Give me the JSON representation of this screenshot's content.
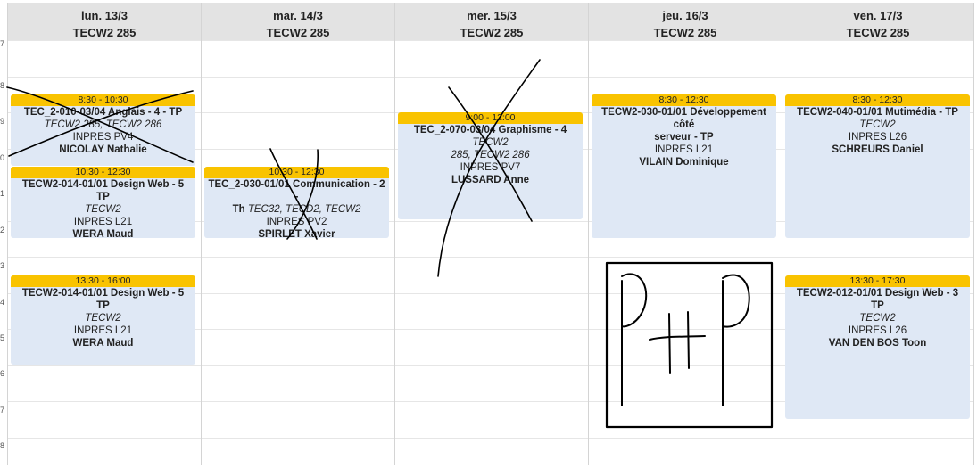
{
  "days": [
    {
      "date": "lun. 13/3",
      "room": "TECW2 285"
    },
    {
      "date": "mar. 14/3",
      "room": "TECW2 285"
    },
    {
      "date": "mer. 15/3",
      "room": "TECW2 285"
    },
    {
      "date": "jeu. 16/3",
      "room": "TECW2 285"
    },
    {
      "date": "ven. 17/3",
      "room": "TECW2 285"
    }
  ],
  "hour_ticks": [
    "7",
    "8",
    "9",
    "0",
    "1",
    "2",
    "3",
    "4",
    "5",
    "6",
    "7",
    "8"
  ],
  "events": [
    {
      "day": 0,
      "time": "8:30 - 10:30",
      "title": "TEC_2-010-03/04 Anglais - 4 - TP",
      "groups": "TECW2 285, TECW2 286",
      "location": "INPRES PV4",
      "teacher": "NICOLAY Nathalie"
    },
    {
      "day": 0,
      "time": "10:30 - 12:30",
      "title": "TECW2-014-01/01 Design Web - 5 TP",
      "groups": "TECW2",
      "location": "INPRES L21",
      "teacher": "WERA Maud"
    },
    {
      "day": 0,
      "time": "13:30 - 16:00",
      "title": "TECW2-014-01/01 Design Web - 5 TP",
      "groups": "TECW2",
      "location": "INPRES L21",
      "teacher": "WERA Maud"
    },
    {
      "day": 1,
      "time": "10:30 - 12:30",
      "title_main": "TEC_2-030-01/01 Communication - 2 -",
      "title_tail": "Th",
      "groups": "TEC32, TECD2, TECW2",
      "location": "INPRES PV2",
      "teacher": "SPIRLET Xavier"
    },
    {
      "day": 2,
      "time": "9:00 - 12:00",
      "title": "TEC_2-070-03/04 Graphisme - 4",
      "groups_a": "TECW2",
      "groups_b": "285, TECW2 286",
      "location": "INPRES PV7",
      "teacher": "LUSSARD Anne"
    },
    {
      "day": 3,
      "time": "8:30 - 12:30",
      "title_l1": "TECW2-030-01/01 Développement côté",
      "title_l2": "serveur - TP",
      "location": "INPRES L21",
      "teacher": "VILAIN Dominique"
    },
    {
      "day": 4,
      "time": "8:30 - 12:30",
      "title": "TECW2-040-01/01 Mutimédia - TP",
      "groups": "TECW2",
      "location": "INPRES L26",
      "teacher": "SCHREURS Daniel"
    },
    {
      "day": 4,
      "time": "13:30 - 17:30",
      "title": "TECW2-012-01/01 Design Web - 3 TP",
      "groups": "TECW2",
      "location": "INPRES L26",
      "teacher": "VAN DEN BOS Toon"
    }
  ],
  "colors": {
    "header_bg": "#e3e3e3",
    "event_bg": "#dfe8f5",
    "event_time_bg": "#f9c300",
    "ink": "#000000"
  }
}
